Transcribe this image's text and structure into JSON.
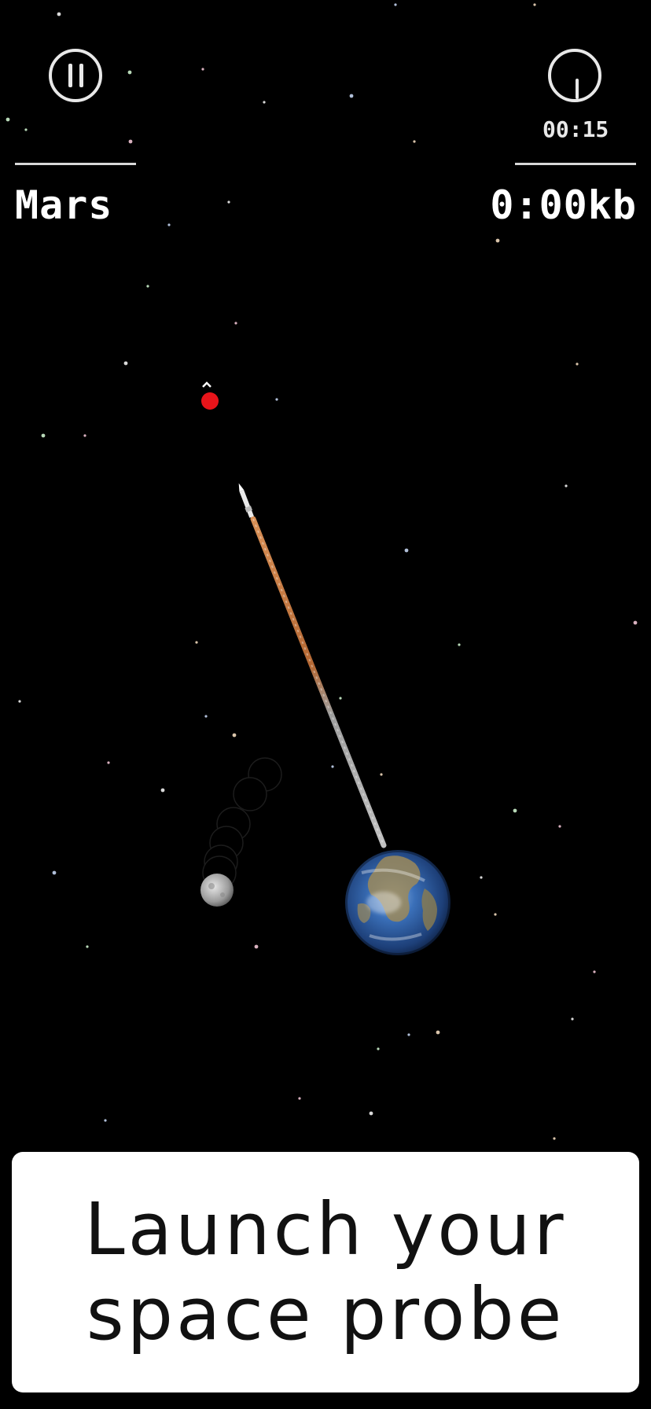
{
  "hud": {
    "pause_icon": "pause-icon",
    "timer_icon": "timer-icon",
    "timer_value": "00:15",
    "target_planet": "Mars",
    "data_collected": "0:00kb"
  },
  "caption": {
    "text": "Launch your\nspace probe"
  },
  "scene": {
    "earth_icon": "earth-planet",
    "moon_icon": "moon",
    "probe_icon": "space-probe-rocket",
    "target_icon": "mars-target-marker",
    "colors": {
      "background": "#000000",
      "target": "#e8141a",
      "trail_hot": "#e07a3a",
      "trail_cool": "#b8b8b8",
      "ocean": "#2b5fa8",
      "land": "#9c8a5a",
      "moon": "#bdbdbd"
    }
  }
}
